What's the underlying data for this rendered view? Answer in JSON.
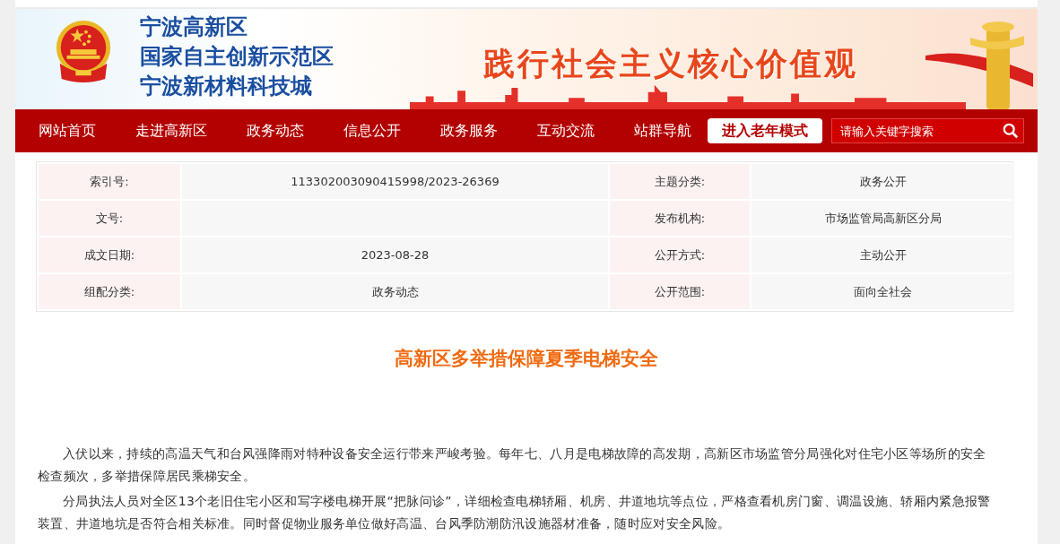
{
  "header": {
    "site_name_lines": [
      "宁波高新区",
      "国家自主创新示范区",
      "宁波新材料科技城"
    ],
    "slogan": "践行社会主义核心价值观"
  },
  "nav": {
    "items": [
      "网站首页",
      "走进高新区",
      "政务动态",
      "信息公开",
      "政务服务",
      "互动交流",
      "站群导航"
    ],
    "elder_mode_button": "进入老年模式",
    "search": {
      "placeholder": "请输入关键字搜索"
    }
  },
  "meta_table": [
    [
      {
        "label": "索引号:",
        "value": "113302003090415998/2023-26369"
      },
      {
        "label": "主题分类:",
        "value": "政务公开"
      }
    ],
    [
      {
        "label": "文号:"
      },
      {
        "label": "发布机构:",
        "value": "市场监管局高新区分局"
      }
    ],
    [
      {
        "label": "成文日期:",
        "value": "2023-08-28"
      },
      {
        "label": "公开方式:",
        "value": "主动公开"
      }
    ],
    [
      {
        "label": "组配分类:",
        "value": "政务动态"
      },
      {
        "label": "公开范围:",
        "value": "面向全社会"
      }
    ]
  ],
  "article": {
    "title": "高新区多举措保障夏季电梯安全",
    "paragraphs": [
      "入伏以来，持续的高温天气和台风强降雨对特种设备安全运行带来严峻考验。每年七、八月是电梯故障的高发期，高新区市场监管分局强化对住宅小区等场所的安全检查频次，多举措保障居民乘梯安全。",
      "分局执法人员对全区13个老旧住宅小区和写字楼电梯开展“把脉问诊”，详细检查电梯轿厢、机房、井道地坑等点位，严格查看机房门窗、调温设施、轿厢内紧急报警装置、井道地坑是否符合相关标准。同时督促物业服务单位做好高温、台风季防潮防汛设施器材准备，随时应对安全风险。"
    ]
  }
}
